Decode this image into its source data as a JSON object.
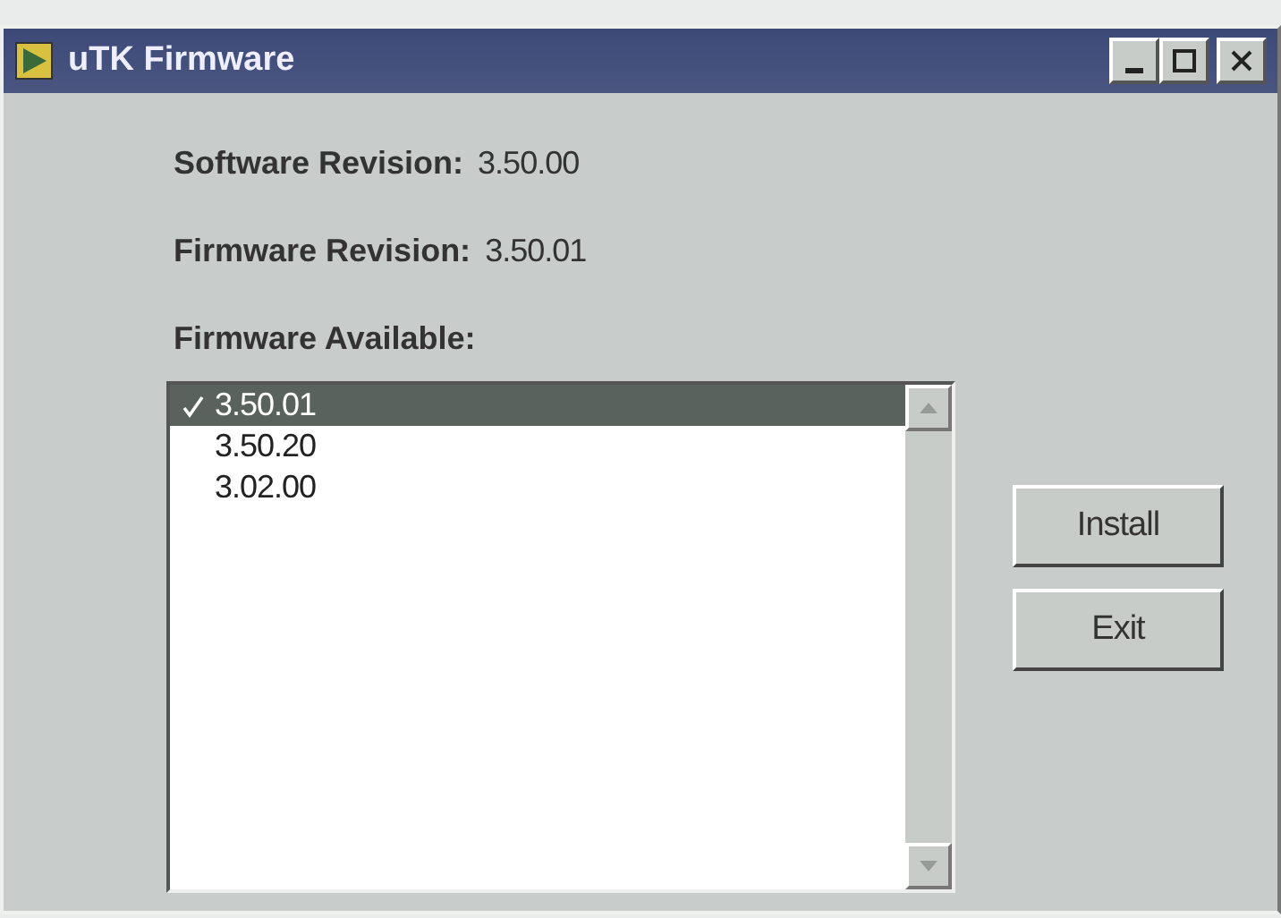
{
  "window": {
    "title": "uTK Firmware"
  },
  "fields": [
    {
      "label": "Software Revision:",
      "value": "3.50.00"
    },
    {
      "label": "Firmware Revision:",
      "value": "3.50.01"
    }
  ],
  "list_label": "Firmware Available:",
  "firmware_list": [
    {
      "version": "3.50.01",
      "selected": true,
      "checked": true
    },
    {
      "version": "3.50.20",
      "selected": false,
      "checked": false
    },
    {
      "version": "3.02.00",
      "selected": false,
      "checked": false
    }
  ],
  "buttons": [
    "Install",
    "Exit"
  ]
}
